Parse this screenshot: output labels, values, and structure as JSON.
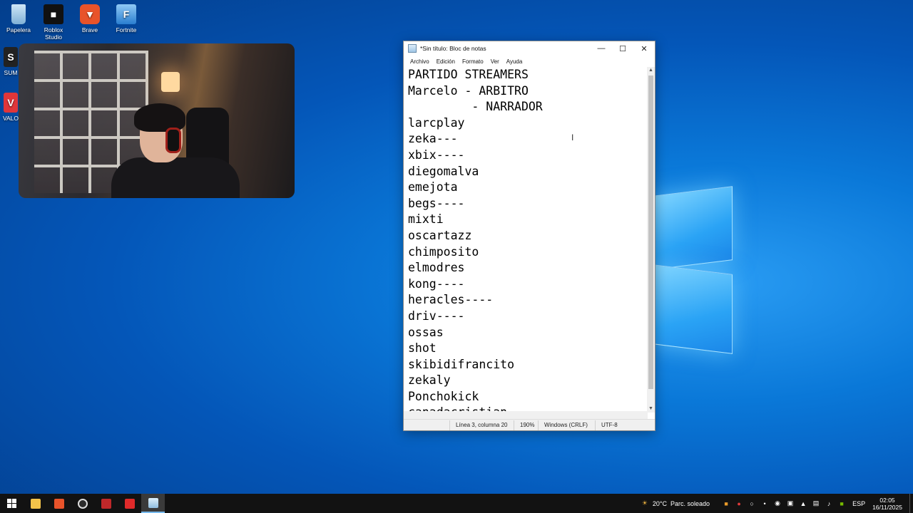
{
  "desktop": {
    "icons": [
      {
        "label": "Papelera",
        "icon": "recycle-bin-icon"
      },
      {
        "label": "Roblox Studio",
        "icon": "roblox-studio-icon"
      },
      {
        "label": "Brave",
        "icon": "brave-icon"
      },
      {
        "label": "Fortnite",
        "icon": "fortnite-icon"
      },
      {
        "label": "SUM",
        "icon": "app-icon"
      },
      {
        "label": "VALO",
        "icon": "valorant-icon"
      }
    ]
  },
  "notepad": {
    "title": "*Sin título: Bloc de notas",
    "menu": [
      "Archivo",
      "Edición",
      "Formato",
      "Ver",
      "Ayuda"
    ],
    "lines": [
      "PARTIDO STREAMERS",
      "Marcelo - ARBITRO",
      "         - NARRADOR",
      "larcplay",
      "zeka---",
      "xbix----",
      "diegomalva",
      "emejota",
      "begs----",
      "mixti",
      "oscartazz",
      "chimposito",
      "elmodres",
      "kong----",
      "heracles----",
      "driv----",
      "ossas",
      "shot",
      "skibidifrancito",
      "zekaly",
      "Ponchokick",
      "canadacristian"
    ],
    "status": {
      "position": "Línea 3, columna 20",
      "zoom": "190%",
      "line_ending": "Windows (CRLF)",
      "encoding": "UTF-8"
    }
  },
  "taskbar": {
    "weather_temp": "20°C",
    "weather_desc": "Parc. soleado",
    "language": "ESP",
    "time": "02:05",
    "date": "16/11/2025"
  }
}
